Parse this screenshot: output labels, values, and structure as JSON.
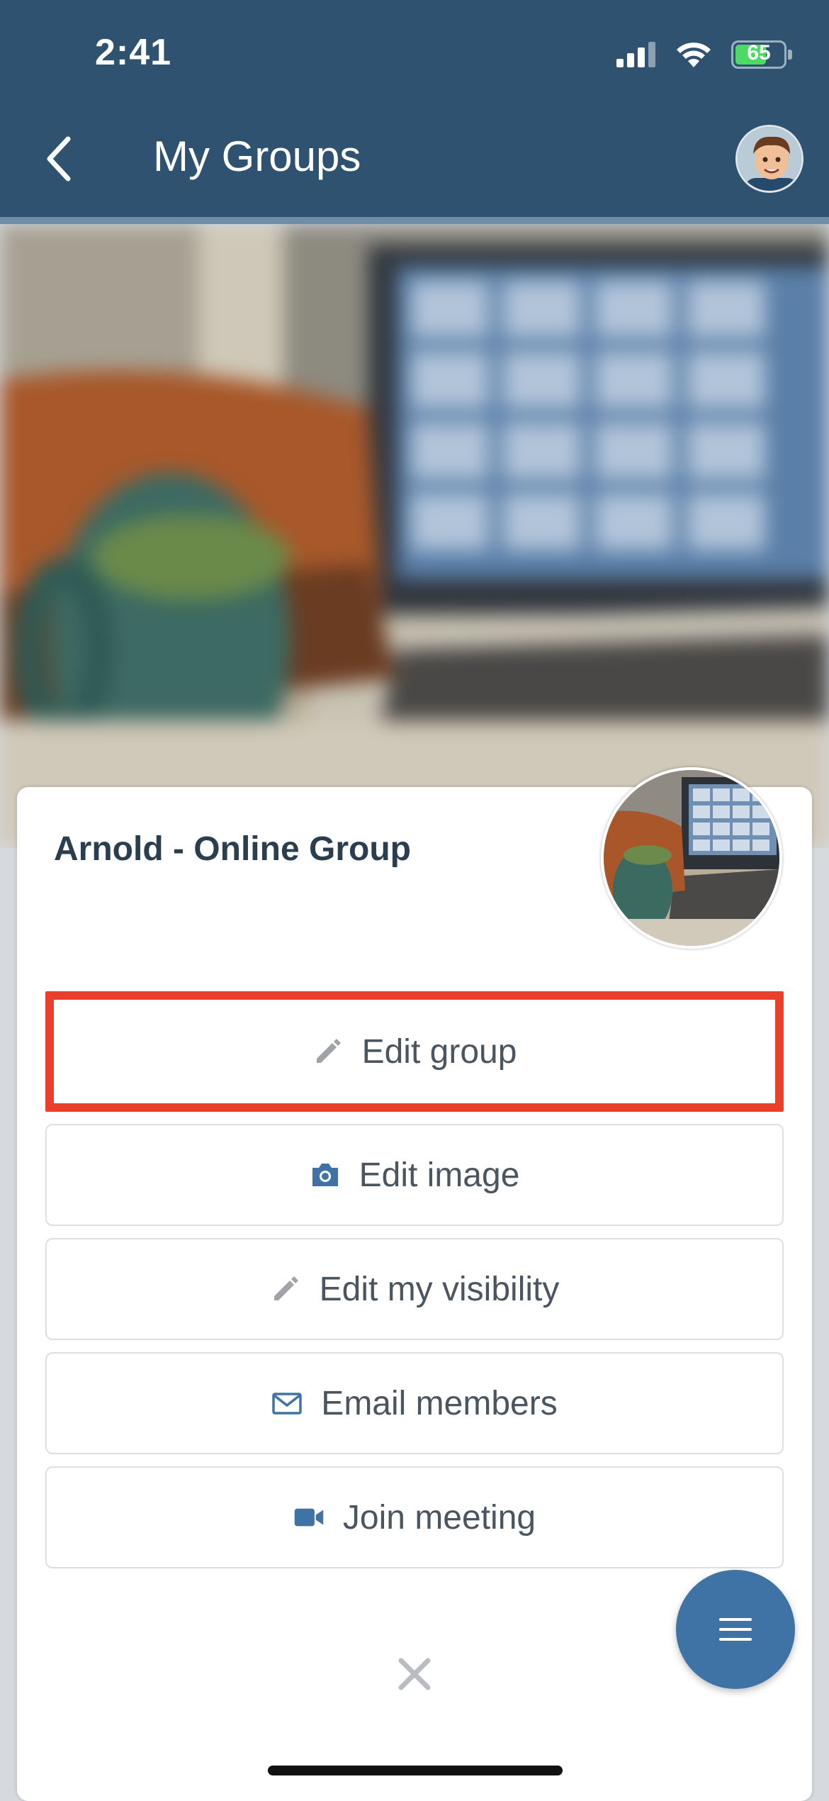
{
  "status_bar": {
    "time": "2:41",
    "battery_percent": "65",
    "battery_level": 0.65,
    "battery_color": "#4cd964"
  },
  "header": {
    "title": "My Groups",
    "back_icon": "chevron-left-icon",
    "avatar": "user-avatar",
    "background_color": "#2e5270"
  },
  "group": {
    "name": "Arnold - Online Group"
  },
  "actions": [
    {
      "label": "Edit group",
      "icon": "pencil-icon",
      "highlighted": true
    },
    {
      "label": "Edit image",
      "icon": "camera-icon",
      "highlighted": false
    },
    {
      "label": "Edit my visibility",
      "icon": "pencil-icon",
      "highlighted": false
    },
    {
      "label": "Email members",
      "icon": "envelope-icon",
      "highlighted": false
    },
    {
      "label": "Join meeting",
      "icon": "video-camera-icon",
      "highlighted": false
    }
  ],
  "close_icon": "close-icon",
  "fab_icon": "menu-icon",
  "colors": {
    "highlight": "#e8402a",
    "accent": "#3f73a5",
    "icon_gray": "#a0a4a8",
    "icon_blue": "#3f73a5"
  }
}
